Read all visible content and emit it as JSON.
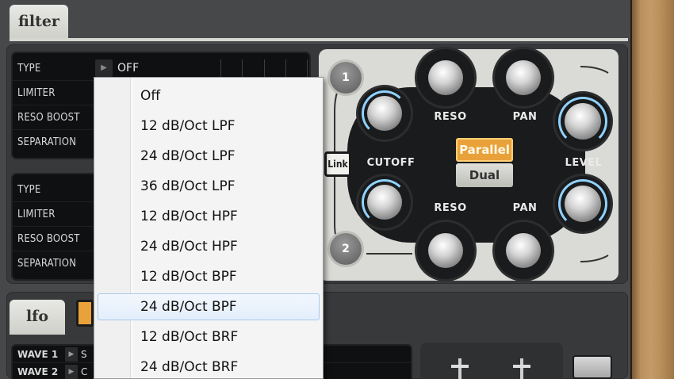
{
  "filter_tab": {
    "label": "filter"
  },
  "lfo_tab": {
    "label": "lfo"
  },
  "filter1": {
    "rows": [
      {
        "label": "TYPE",
        "value": "OFF"
      },
      {
        "label": "LIMITER",
        "value": ""
      },
      {
        "label": "RESO BOOST",
        "value": ""
      },
      {
        "label": "SEPARATION",
        "value": ""
      }
    ]
  },
  "filter2": {
    "rows": [
      {
        "label": "TYPE",
        "value": ""
      },
      {
        "label": "LIMITER",
        "value": ""
      },
      {
        "label": "RESO BOOST",
        "value": ""
      },
      {
        "label": "SEPARATION",
        "value": ""
      }
    ]
  },
  "routing": {
    "badge1": "1",
    "badge2": "2",
    "link_label": "Link",
    "parallel_label": "Parallel",
    "dual_label": "Dual",
    "cutoff_label": "CUTOFF",
    "level_label": "LEVEL",
    "reso_label": "RESO",
    "pan_label": "PAN",
    "active_mode": "Parallel",
    "accent_color": "#e9a23a"
  },
  "type_dropdown": {
    "options": [
      "Off",
      "12 dB/Oct LPF",
      "24 dB/Oct LPF",
      "36 dB/Oct LPF",
      "12 dB/Oct HPF",
      "24 dB/Oct HPF",
      "12 dB/Oct BPF",
      "24 dB/Oct BPF",
      "12 dB/Oct BRF",
      "24 dB/Oct BRF"
    ],
    "highlighted": "24 dB/Oct BPF"
  },
  "lfo": {
    "rows": [
      {
        "label": "WAVE 1",
        "value": "S"
      },
      {
        "label": "WAVE 2",
        "value": "C"
      }
    ]
  }
}
